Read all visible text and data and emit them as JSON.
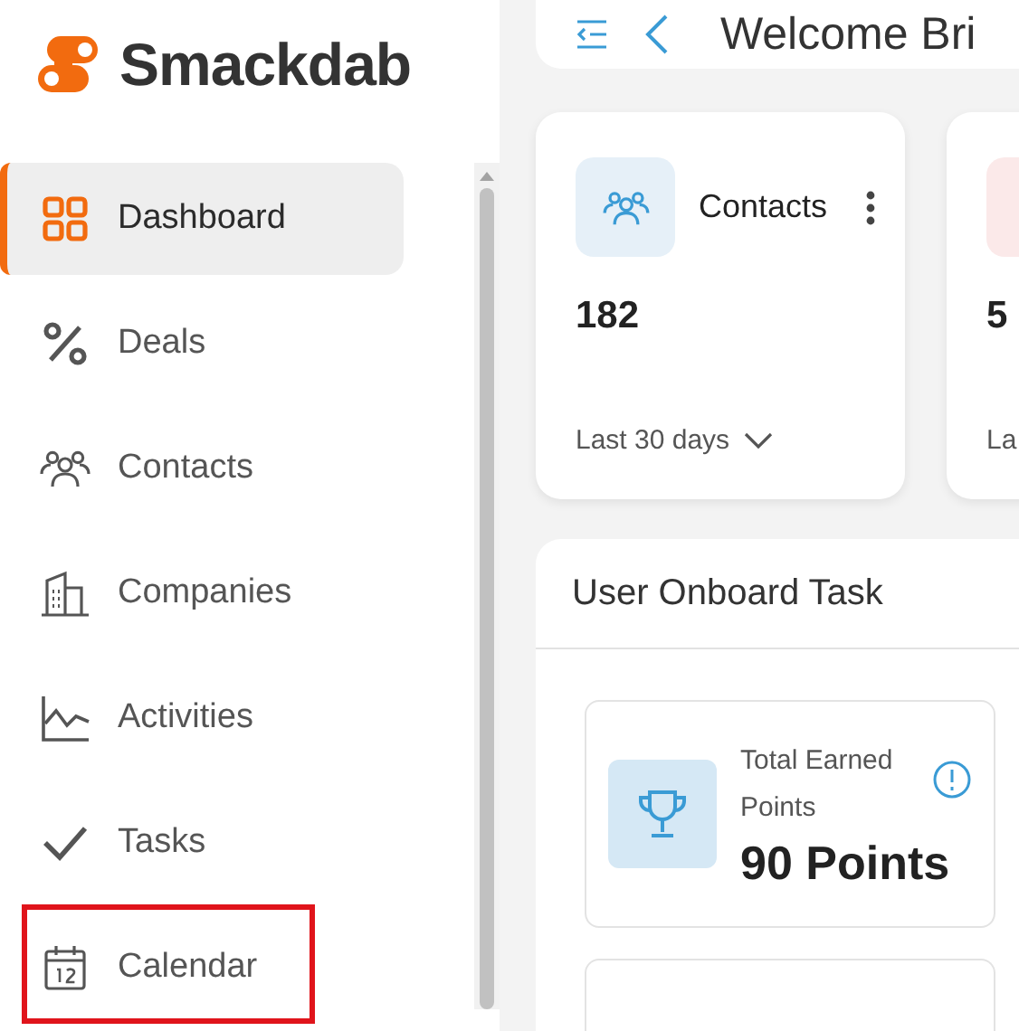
{
  "brand": {
    "name": "Smackdab"
  },
  "sidebar": {
    "items": [
      {
        "label": "Dashboard",
        "selected": true,
        "highlighted": false
      },
      {
        "label": "Deals",
        "selected": false,
        "highlighted": false
      },
      {
        "label": "Contacts",
        "selected": false,
        "highlighted": false
      },
      {
        "label": "Companies",
        "selected": false,
        "highlighted": false
      },
      {
        "label": "Activities",
        "selected": false,
        "highlighted": false
      },
      {
        "label": "Tasks",
        "selected": false,
        "highlighted": false
      },
      {
        "label": "Calendar",
        "selected": false,
        "highlighted": true
      }
    ]
  },
  "header": {
    "title": "Welcome Bri"
  },
  "stat_cards": [
    {
      "label": "Contacts",
      "value": "182",
      "period": "Last 30 days",
      "color": "#e6f0f8"
    },
    {
      "value": "5",
      "period": "La",
      "color": "#fbe9e9"
    }
  ],
  "onboard": {
    "title": "User Onboard Task",
    "cards": [
      {
        "label": "Total Earned Points",
        "value": "90 Points"
      }
    ]
  }
}
